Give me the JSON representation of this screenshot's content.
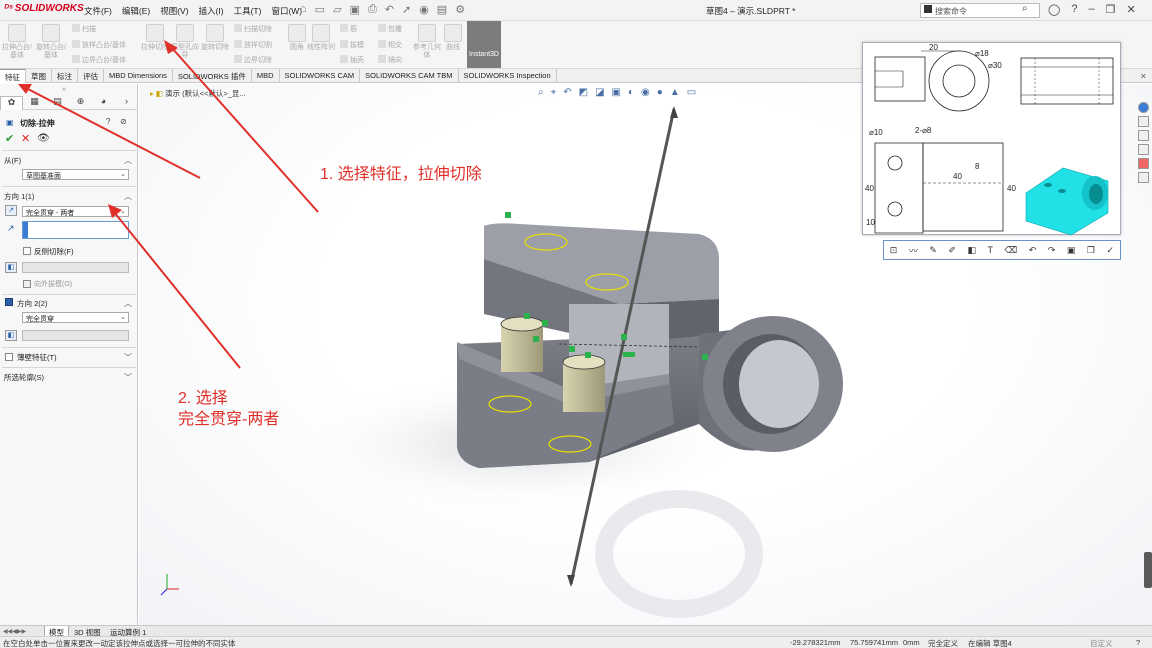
{
  "app": {
    "brand": "SOLIDWORKS",
    "doc_title": "草图4 – 演示.SLDPRT *",
    "search_placeholder": "搜索命令"
  },
  "menu": [
    "文件(F)",
    "编辑(E)",
    "视图(V)",
    "插入(I)",
    "工具(T)",
    "窗口(W)"
  ],
  "ribbon": {
    "buttons": [
      {
        "label": "拉伸凸台/基体"
      },
      {
        "label": "旋转凸台/基体"
      },
      {
        "label": "拉伸切除"
      },
      {
        "label": "异型孔向导"
      },
      {
        "label": "旋转切除"
      },
      {
        "label": "圆角"
      },
      {
        "label": "线性阵列"
      },
      {
        "label": "参考几何体"
      },
      {
        "label": "曲线"
      }
    ],
    "small": [
      "扫描",
      "放样凸台/基体",
      "边界凸台/基体",
      "扫描切除",
      "放样切割",
      "边界切除",
      "筋",
      "拔模",
      "抽壳",
      "包覆",
      "相交",
      "镜向"
    ],
    "instant3d": "Instant3D"
  },
  "tabs": [
    "特征",
    "草图",
    "标注",
    "评估",
    "MBD Dimensions",
    "SOLIDWORKS 插件",
    "MBD",
    "SOLIDWORKS CAM",
    "SOLIDWORKS CAM TBM",
    "SOLIDWORKS Inspection"
  ],
  "feature": {
    "title": "切除-拉伸",
    "from_label": "从(F)",
    "from_value": "草图基准面",
    "dir1_label": "方向 1(1)",
    "dir1_value": "完全贯穿 - 两者",
    "flip_side": "反侧切除(F)",
    "draft_outward": "向外拔模(O)",
    "dir2_label": "方向 2(2)",
    "dir2_value": "完全贯穿",
    "thin_feature": "薄壁特征(T)",
    "selected_contours": "所选轮廓(S)"
  },
  "breadcrumb": "演示 (默认<<默认>_显...",
  "annotations": {
    "step1": "1. 选择特征，拉伸切除",
    "step2_line1": "2. 选择",
    "step2_line2": "完全贯穿-两者"
  },
  "drawing": {
    "dims": [
      "20",
      "⌀18",
      "⌀30",
      "⌀10",
      "2-⌀8",
      "40",
      "40",
      "10",
      "40",
      "8"
    ]
  },
  "bottom_tabs": [
    "模型",
    "3D 视图",
    "运动算例 1"
  ],
  "status": {
    "hint": "在空白处单击一位置来更改一动定该拉伸点或选择一可拉伸的不同实体",
    "x": "-29.278321mm",
    "y": "75.759741mm",
    "z": "0mm",
    "state": "完全定义",
    "editing": "在编辑 草图4",
    "units": "自定义"
  },
  "colors": {
    "accent_red": "#e0302a",
    "cyan_part": "#21e0e6",
    "part_gray": "#8a8c94",
    "sketch_green": "#2bb24c"
  }
}
